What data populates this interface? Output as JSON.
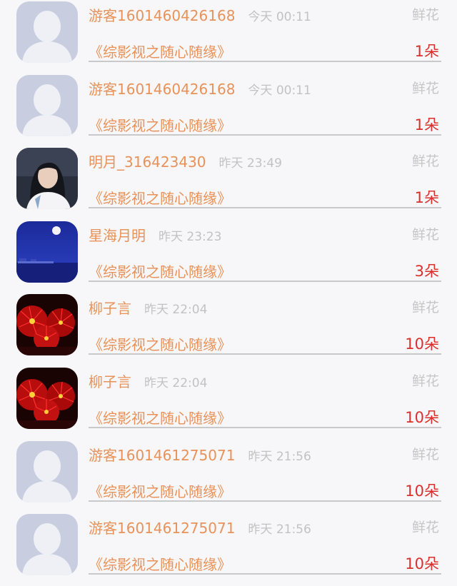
{
  "gift_list": [
    {
      "avatar": "default-avatar",
      "name": "游客1601460426168",
      "time": "今天 00:11",
      "gift": "鲜花",
      "source": "《综影视之随心随缘》",
      "count": "1朵"
    },
    {
      "avatar": "default-avatar",
      "name": "游客1601460426168",
      "time": "今天 00:11",
      "gift": "鲜花",
      "source": "《综影视之随心随缘》",
      "count": "1朵"
    },
    {
      "avatar": "portrait-photo",
      "name": "明月_316423430",
      "time": "昨天 23:49",
      "gift": "鲜花",
      "source": "《综影视之随心随缘》",
      "count": "1朵"
    },
    {
      "avatar": "night-moon-photo",
      "name": "星海月明",
      "time": "昨天 23:23",
      "gift": "鲜花",
      "source": "《综影视之随心随缘》",
      "count": "3朵"
    },
    {
      "avatar": "red-spider-lily-photo",
      "name": "柳子言",
      "time": "昨天 22:04",
      "gift": "鲜花",
      "source": "《综影视之随心随缘》",
      "count": "10朵"
    },
    {
      "avatar": "red-spider-lily-photo",
      "name": "柳子言",
      "time": "昨天 22:04",
      "gift": "鲜花",
      "source": "《综影视之随心随缘》",
      "count": "10朵"
    },
    {
      "avatar": "default-avatar",
      "name": "游客1601461275071",
      "time": "昨天 21:56",
      "gift": "鲜花",
      "source": "《综影视之随心随缘》",
      "count": "10朵"
    },
    {
      "avatar": "default-avatar",
      "name": "游客1601461275071",
      "time": "昨天 21:56",
      "gift": "鲜花",
      "source": "《综影视之随心随缘》",
      "count": "10朵"
    }
  ],
  "colors": {
    "background": "#f7f7f9",
    "name": "#e8925a",
    "time": "#c2c2c2",
    "gift_label": "#c6c6c6",
    "count": "#d9302c",
    "divider": "#c9c9c9",
    "default_avatar_bg": "#c8cde0"
  }
}
